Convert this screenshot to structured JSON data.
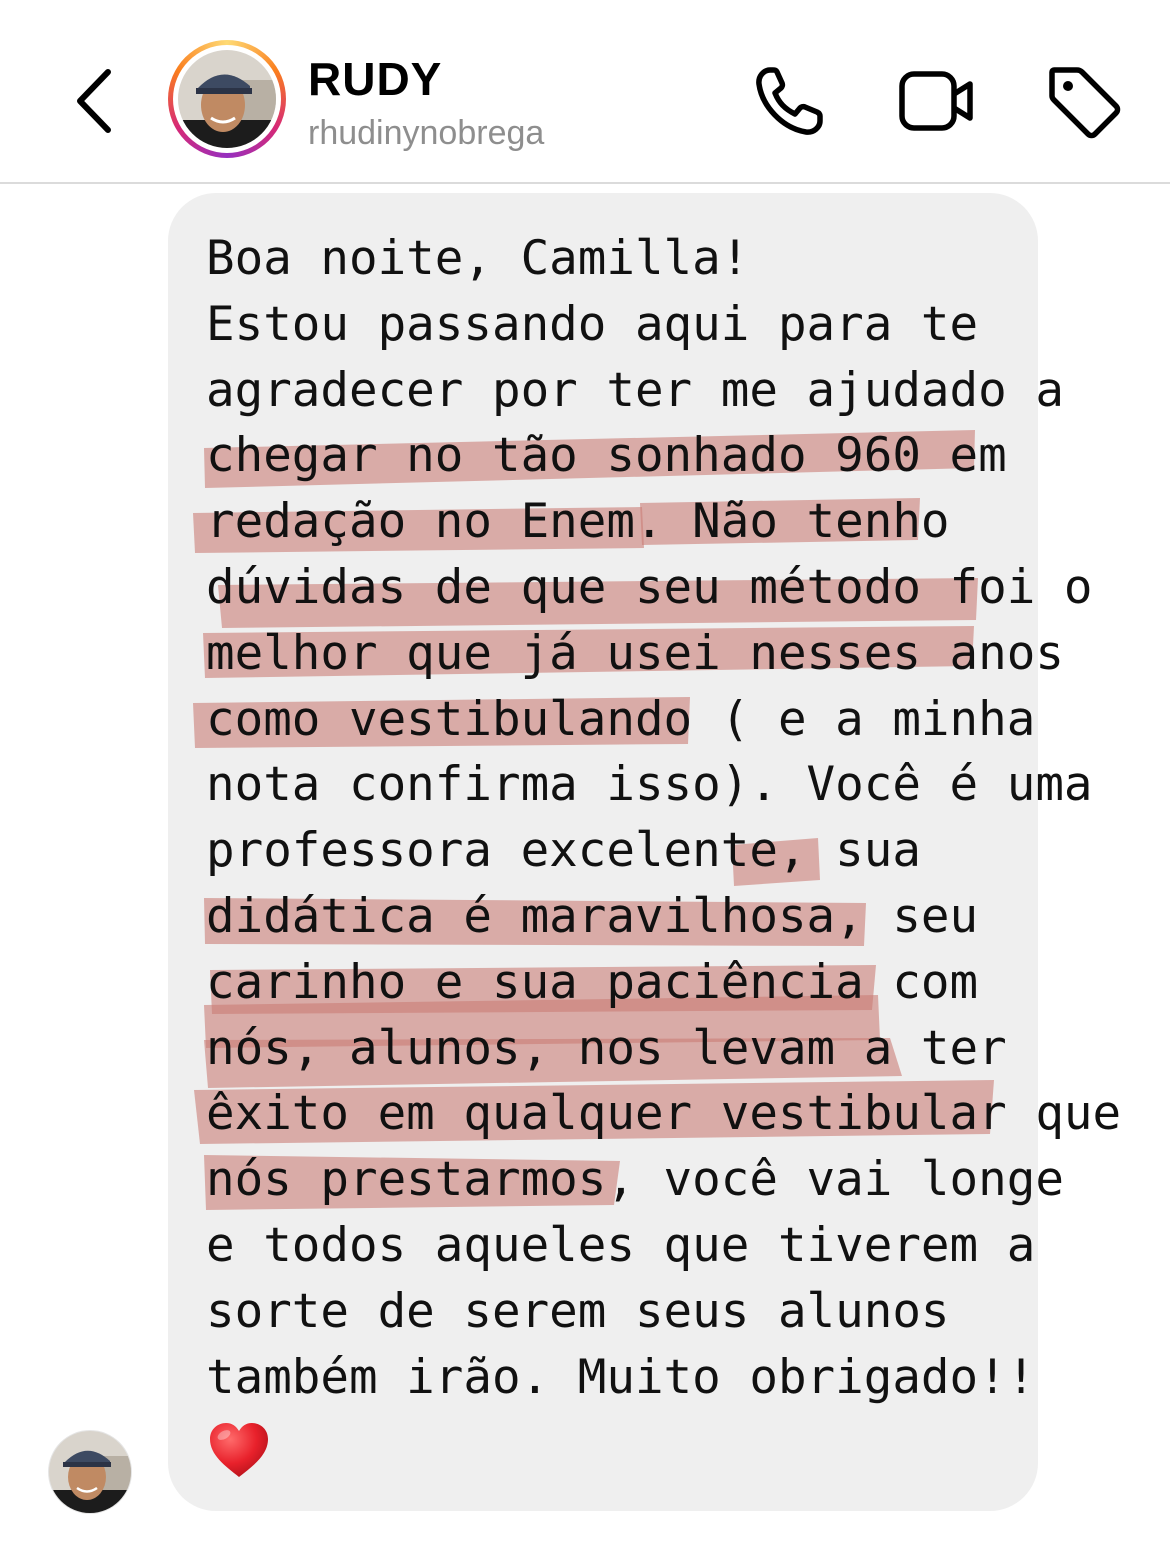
{
  "header": {
    "back_icon": "chevron-left-icon",
    "contact_name": "RUDY",
    "username": "rhudinynobrega",
    "actions": [
      {
        "name": "voice-call",
        "icon": "phone-icon"
      },
      {
        "name": "video-call",
        "icon": "video-camera-icon"
      },
      {
        "name": "label",
        "icon": "tag-icon"
      }
    ]
  },
  "message": {
    "lines": [
      "Boa noite, Camilla!",
      "Estou passando aqui para te",
      "agradecer por ter me ajudado a",
      "chegar no tão sonhado 960 em",
      "redação no Enem. Não tenho",
      "dúvidas de que seu método foi o",
      "melhor que já usei nesses anos",
      "como vestibulando ( e a minha",
      "nota confirma isso). Você é uma",
      "professora excelente, sua",
      "didática é maravilhosa, seu",
      "carinho e sua paciência com",
      "nós, alunos, nos levam a ter",
      "êxito em qualquer vestibular que",
      "nós prestarmos, você vai longe",
      "e todos aqueles que tiverem a",
      "sorte de serem seus alunos",
      "também irão. Muito obrigado!!"
    ],
    "emoji": "heart-icon",
    "highlight_color": "#c97b73",
    "bubble_color": "#efefef"
  }
}
